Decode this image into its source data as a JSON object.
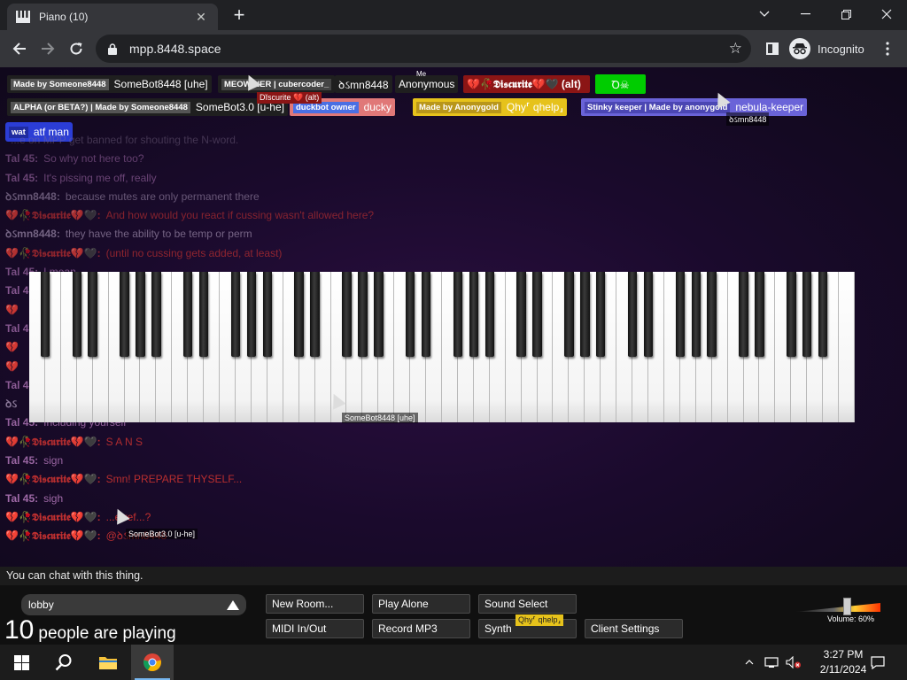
{
  "browser": {
    "tab_title": "Piano (10)",
    "url": "mpp.8448.space",
    "incognito_label": "Incognito",
    "icons": [
      "piano-favicon-icon",
      "close-icon",
      "plus-icon",
      "minimize-icon",
      "maximize-icon",
      "chevron-down-icon",
      "back-icon",
      "forward-icon",
      "reload-icon",
      "lock-icon",
      "star-icon",
      "side-panel-icon",
      "incognito-icon",
      "menu-icon"
    ]
  },
  "name_tags": {
    "row1": [
      {
        "label": "Made by Someone8448",
        "name": "SomeBot8448 [uhe]",
        "color": "#1f1f1f",
        "label_bg": "#555555"
      },
      {
        "label": "MEOW NER | cubercoder_",
        "name": "",
        "color": "#1f1f1f",
        "label_bg": "#444444"
      },
      {
        "label": "",
        "name": "ꝺઽmn8448",
        "color": "#1f1f1f",
        "label_bg": ""
      },
      {
        "label": "Me",
        "name": "Anonymous",
        "color": "#1f1f1f",
        "label_bg": ""
      },
      {
        "label": "",
        "name": "💔🥀𝕯𝖎𝖘𝖈𝖚𝖗𝖎𝖙𝖊💔🖤 (alt)",
        "color": "#8b1515",
        "label_bg": ""
      },
      {
        "label": "",
        "name": "Ꝺ☠",
        "color": "#00cc00",
        "label_bg": ""
      }
    ],
    "row2": [
      {
        "label": "ALPHA (or BETA?) | Made by Someone8448",
        "name": "SomeBot3.0 [u-he]",
        "color": "#1f1f1f",
        "label_bg": "#555555"
      },
      {
        "label": "duckbot owner",
        "name": "ducky",
        "color": "#e07878",
        "label_bg": "#4a6fe3"
      },
      {
        "label": "Made by Anonygold",
        "name": "Qhy⸢ qhelp⸥",
        "color": "#e6c21b",
        "label_bg": "#b8961a"
      },
      {
        "label": "Stinky keeper | Made by anonygold",
        "name": "nebula-keeper",
        "color": "#6a63d8",
        "label_bg": "#4b46b3"
      }
    ],
    "row3": [
      {
        "label": "wat",
        "name": "atf man",
        "color": "#2b3dd6",
        "label_bg": "#1f2ba0"
      }
    ]
  },
  "chat": {
    "messages": [
      {
        "name": "",
        "text": "...e on MPP get banned for shouting the N-word.",
        "color": "#7a6a88",
        "opacity": 0.45
      },
      {
        "name": "Tal 45:",
        "text": "So why not here too?",
        "color": "#a06aa8",
        "opacity": 0.55
      },
      {
        "name": "Tal 45:",
        "text": "It's pissing me off, really",
        "color": "#a06aa8",
        "opacity": 0.6
      },
      {
        "name": "ꝺઽmn8448:",
        "text": "because mutes are only permanent there",
        "color": "#9c8aaa",
        "opacity": 0.6
      },
      {
        "name": "💔🥀𝕯𝖎𝖘𝖈𝖚𝖗𝖎𝖙𝖊💔🖤:",
        "text": "And how would you react if cussing wasn't allowed here?",
        "color": "#c03030",
        "opacity": 0.65
      },
      {
        "name": "ꝺઽmn8448:",
        "text": "they have the ability to be temp or perm",
        "color": "#9c8aaa",
        "opacity": 0.7
      },
      {
        "name": "💔🥀𝕯𝖎𝖘𝖈𝖚𝖗𝖎𝖙𝖊💔🖤:",
        "text": "(until no cussing gets added, at least)",
        "color": "#c03030",
        "opacity": 0.7
      },
      {
        "name": "Tal 45:",
        "text": "I mean",
        "color": "#a06aa8",
        "opacity": 0.7
      },
      {
        "name": "Tal 4",
        "text": "",
        "color": "#a06aa8",
        "opacity": 0.8
      },
      {
        "name": "💔",
        "text": "",
        "color": "#c03030",
        "opacity": 0.8
      },
      {
        "name": "Tal 4",
        "text": "",
        "color": "#a06aa8",
        "opacity": 0.8
      },
      {
        "name": "💔",
        "text": "",
        "color": "#c03030",
        "opacity": 0.85
      },
      {
        "name": "💔",
        "text": "",
        "color": "#c03030",
        "opacity": 0.85
      },
      {
        "name": "Tal 4",
        "text": "",
        "color": "#a06aa8",
        "opacity": 0.85
      },
      {
        "name": "ꝺઽ",
        "text": "",
        "color": "#9c8aaa",
        "opacity": 0.85
      },
      {
        "name": "Tal 45:",
        "text": "Including yourself",
        "color": "#a06aa8",
        "opacity": 0.9
      },
      {
        "name": "💔🥀𝕯𝖎𝖘𝖈𝖚𝖗𝖎𝖙𝖊💔🖤:",
        "text": "S A N S",
        "color": "#c03030",
        "opacity": 0.9
      },
      {
        "name": "Tal 45:",
        "text": "sign",
        "color": "#a06aa8",
        "opacity": 0.95
      },
      {
        "name": "💔🥀𝕯𝖎𝖘𝖈𝖚𝖗𝖎𝖙𝖊💔🖤:",
        "text": "Smn! PREPARE THYSELF...",
        "color": "#c03030",
        "opacity": 0.95
      },
      {
        "name": "Tal 45:",
        "text": "sigh",
        "color": "#a06aa8",
        "opacity": 1
      },
      {
        "name": "💔🥀𝕯𝖎𝖘𝖈𝖚𝖗𝖎𝖙𝖊💔🖤:",
        "text": "...e ref...?",
        "color": "#c03030",
        "opacity": 1
      },
      {
        "name": "💔🥀𝕯𝖎𝖘𝖈𝖚𝖗𝖎𝖙𝖊💔🖤:",
        "text": "@ꝺઽmn8448",
        "color": "#c03030",
        "opacity": 1
      }
    ],
    "input_placeholder": "You can chat with this thing."
  },
  "cursors": [
    {
      "label": "Dĭscurite 💔 (alt)",
      "label_bg": "#8b1515"
    },
    {
      "label": "ꝺઽmn8448",
      "label_bg": "#000000"
    },
    {
      "label": "SomeBot8448 [uhe]",
      "label_bg": "#000000"
    },
    {
      "label": "SomeBot3.0 [u-he]",
      "label_bg": "#000000"
    },
    {
      "label": "Qhy⸢ qhelp⸥",
      "label_bg": "#e6c21b"
    }
  ],
  "piano": {
    "white_keys": 52
  },
  "room": {
    "name": "lobby",
    "player_count": "10",
    "player_count_label": "people are playing"
  },
  "buttons": {
    "new_room": "New Room...",
    "play_alone": "Play Alone",
    "sound_select": "Sound Select",
    "midi": "MIDI In/Out",
    "record_mp3": "Record MP3",
    "synth": "Synth",
    "client_settings": "Client Settings"
  },
  "volume": {
    "label": "Volume: 60%",
    "value": 0.6
  },
  "taskbar": {
    "time": "3:27 PM",
    "date": "2/11/2024",
    "icons": [
      "windows-start-icon",
      "search-icon",
      "file-explorer-icon",
      "chrome-icon"
    ],
    "tray_icons": [
      "chevron-up-icon",
      "network-icon",
      "volume-muted-icon",
      "notification-icon"
    ]
  },
  "colors": {
    "accent_blue": "#77b7f0",
    "page_bg": "#1a0a2c"
  }
}
